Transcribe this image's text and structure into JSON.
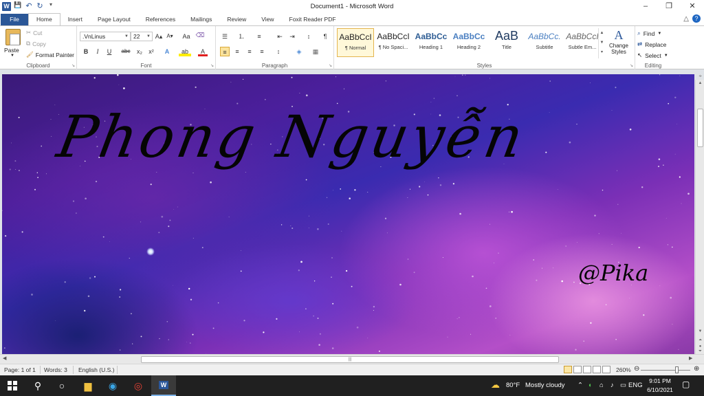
{
  "window": {
    "title": "Document1 - Microsoft Word",
    "app_icon_letter": "W",
    "controls": {
      "minimize": "–",
      "restore": "❐",
      "close": "✕"
    },
    "quick_access": {
      "save": "💾",
      "undo": "↶",
      "redo": "↻",
      "customize": "▾"
    }
  },
  "tabs": [
    "File",
    "Home",
    "Insert",
    "Page Layout",
    "References",
    "Mailings",
    "Review",
    "View",
    "Foxit Reader PDF"
  ],
  "tab_extras": {
    "collapse": "△",
    "help": "?"
  },
  "ribbon": {
    "clipboard": {
      "label": "Clipboard",
      "paste": "Paste",
      "cut": "Cut",
      "copy": "Copy",
      "format_painter": "Format Painter"
    },
    "font": {
      "label": "Font",
      "font_name": ".VnLinus",
      "font_size": "22",
      "buttons": {
        "bold": "B",
        "italic": "I",
        "underline": "U",
        "strike": "abc",
        "subscript": "x₂",
        "superscript": "x²",
        "grow": "A▴",
        "shrink": "A▾",
        "change_case": "Aa",
        "clear": "⌫",
        "effects": "A",
        "highlight": "ab",
        "color": "A"
      }
    },
    "paragraph": {
      "label": "Paragraph",
      "buttons": {
        "bullets": "☰",
        "numbering": "⒈",
        "multilevel": "≡",
        "decrease_indent": "⇤",
        "increase_indent": "⇥",
        "sort": "↕",
        "show_marks": "¶",
        "align_left": "≡",
        "center": "≡",
        "align_right": "≡",
        "justify": "≡",
        "line_spacing": "↕",
        "shading": "◈",
        "borders": "▦"
      }
    },
    "styles": {
      "label": "Styles",
      "items": [
        {
          "preview": "AaBbCcI",
          "name": "¶ Normal",
          "selected": true
        },
        {
          "preview": "AaBbCcI",
          "name": "¶ No Spaci..."
        },
        {
          "preview": "AaBbCc",
          "name": "Heading 1"
        },
        {
          "preview": "AaBbCc",
          "name": "Heading 2"
        },
        {
          "preview": "AaB",
          "name": "Title"
        },
        {
          "preview": "AaBbCc.",
          "name": "Subtitle"
        },
        {
          "preview": "AaBbCcI",
          "name": "Subtle Em..."
        }
      ],
      "change_styles": "Change Styles"
    },
    "editing": {
      "label": "Editing",
      "find": "Find",
      "replace": "Replace",
      "select": "Select"
    }
  },
  "document": {
    "title_text": "Phong Nguyễn",
    "signature_text": "@Pika",
    "colors": {
      "deep": "#3a1a78",
      "violet": "#7a2fb6",
      "pink": "#b44fc8",
      "text": "#050505"
    }
  },
  "statusbar": {
    "page": "Page: 1 of 1",
    "words": "Words: 3",
    "language": "English (U.S.)",
    "zoom": "260%"
  },
  "taskbar": {
    "weather_temp": "80°F",
    "weather_text": "Mostly cloudy",
    "language": "ENG",
    "time": "9:01 PM",
    "date": "6/10/2021",
    "apps": [
      "windows-start",
      "search",
      "cortana",
      "file-explorer",
      "edge",
      "chrome",
      "word"
    ]
  }
}
